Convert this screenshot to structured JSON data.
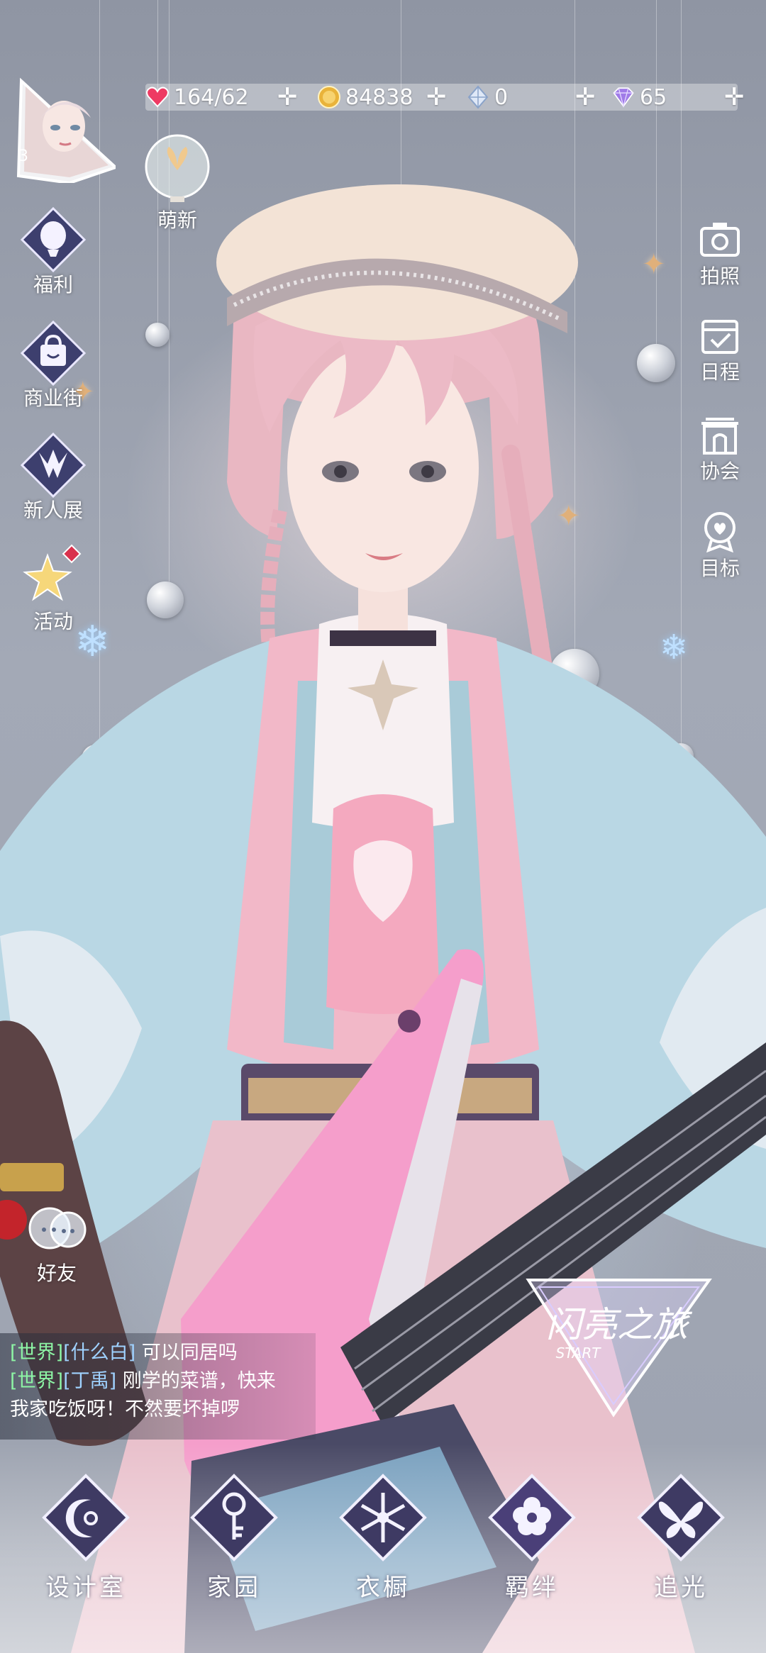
{
  "player": {
    "level": "3"
  },
  "resources": {
    "stamina": "164/62",
    "gold": "84838",
    "crystal": "0",
    "diamond": "65"
  },
  "left_menu": [
    {
      "label": "福利",
      "icon": "balloon-icon"
    },
    {
      "label": "商业街",
      "icon": "shopping-bag-icon"
    },
    {
      "label": "新人展",
      "icon": "crown-v-icon"
    },
    {
      "label": "活动",
      "icon": "stars-icon"
    }
  ],
  "new_player": {
    "label": "萌新"
  },
  "right_menu": [
    {
      "label": "拍照",
      "icon": "camera-icon"
    },
    {
      "label": "日程",
      "icon": "calendar-icon"
    },
    {
      "label": "协会",
      "icon": "building-icon"
    },
    {
      "label": "目标",
      "icon": "target-badge-icon"
    }
  ],
  "friends": {
    "label": "好友"
  },
  "chat": [
    {
      "channel": "[世界]",
      "name": "[什么白]",
      "text": " 可以同居吗"
    },
    {
      "channel": "[世界]",
      "name": "[丁禹]",
      "text": " 刚学的菜谱，快来"
    },
    {
      "channel": "",
      "name": "",
      "text": "我家吃饭呀！不然要坏掉啰"
    }
  ],
  "event_logo": {
    "title": "闪亮之旅",
    "sub": "START"
  },
  "bottom_nav": [
    {
      "label": "设计室",
      "icon": "moon-icon"
    },
    {
      "label": "家园",
      "icon": "key-icon"
    },
    {
      "label": "衣橱",
      "icon": "snowflake-icon"
    },
    {
      "label": "羁绊",
      "icon": "flower-icon"
    },
    {
      "label": "追光",
      "icon": "butterfly-icon"
    }
  ]
}
